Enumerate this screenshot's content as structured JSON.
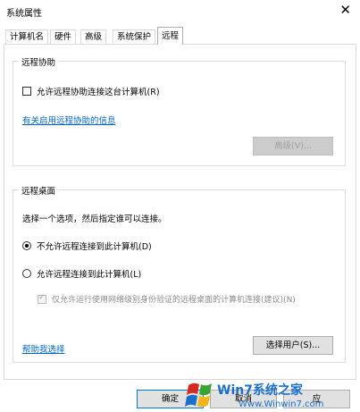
{
  "window": {
    "title": "系统属性",
    "close_glyph": "✕"
  },
  "tabs": [
    "计算机名",
    "硬件",
    "高级",
    "系统保护",
    "远程"
  ],
  "active_tab": "远程",
  "remote_assistance": {
    "group_title": "远程协助",
    "checkbox_label": "允许远程协助连接这台计算机(R)",
    "checked": false,
    "info_link": "有关启用远程协助的信息",
    "advanced_button": "高级(V)..."
  },
  "remote_desktop": {
    "group_title": "远程桌面",
    "instruction": "选择一个选项，然后指定谁可以连接。",
    "options": [
      "不允许远程连接到此计算机(D)",
      "允许远程连接到此计算机(L)"
    ],
    "selected_option": 0,
    "nla_checkbox_label": "仅允许运行使用网络级别身份验证的远程桌面的计算机连接(建议)(N)",
    "nla_checked": true,
    "help_link": "帮助我选择",
    "select_users_button": "选择用户(S)..."
  },
  "footer": {
    "ok": "确定",
    "cancel": "取消",
    "apply": "应"
  },
  "watermark": {
    "brand": "Win7系统之家",
    "url": "Www.Winwin7.com"
  },
  "colors": {
    "link": "#0066cc",
    "win_red": "#d62a20",
    "win_blue": "#1a6fcb",
    "win_green": "#3aa335",
    "win_yellow": "#f3b51a"
  }
}
